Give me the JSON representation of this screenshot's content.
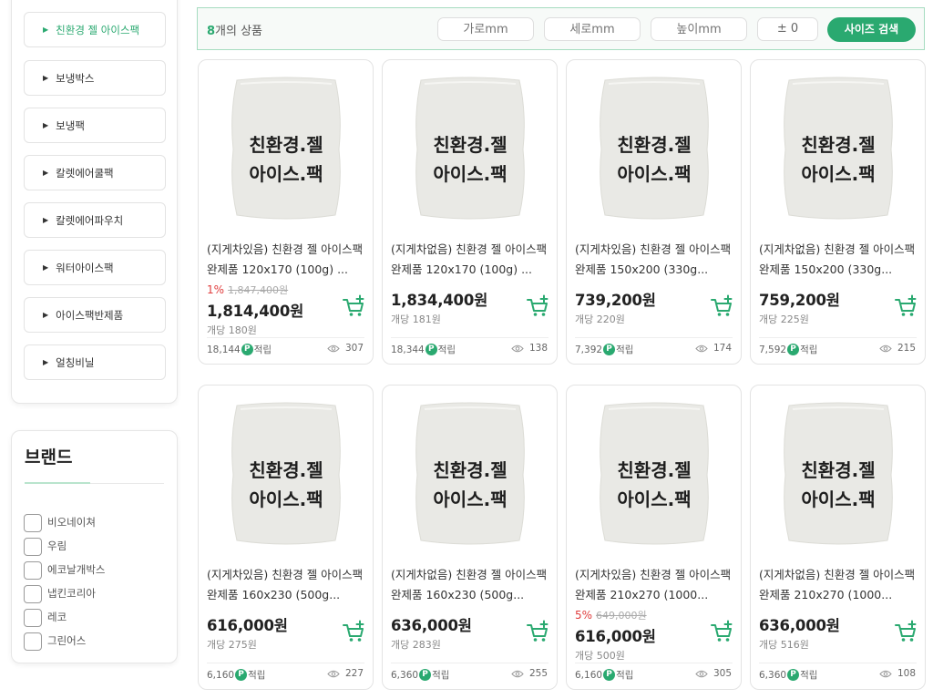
{
  "sidebar": {
    "categories": [
      {
        "label": "친환경 젤 아이스팩"
      },
      {
        "label": "보냉박스"
      },
      {
        "label": "보냉팩"
      },
      {
        "label": "칼렛에어쿨팩"
      },
      {
        "label": "칼렛에어파우치"
      },
      {
        "label": "워터아이스팩"
      },
      {
        "label": "아이스팩반제품"
      },
      {
        "label": "얼칭비닐"
      }
    ],
    "brand_title": "브랜드",
    "brands": [
      "비오네이쳐",
      "우림",
      "에코날개박스",
      "냅킨코리아",
      "레코",
      "그린어스"
    ]
  },
  "search": {
    "count_number": "8",
    "count_suffix": "개의 상품",
    "width_placeholder": "가로mm",
    "depth_placeholder": "세로mm",
    "height_placeholder": "높이mm",
    "tolerance": "± 0",
    "button": "사이즈 검색"
  },
  "colors": {
    "accent": "#2aa970",
    "discount": "#e03c3c",
    "bag": "#e9e9e5"
  },
  "icons": {
    "cart": "cart-plus-icon",
    "views": "eye-icon",
    "points": "point-badge-icon",
    "bullet": "triangle-right-icon"
  },
  "product_image_text": [
    "친환경.젤",
    "아이스.팩"
  ],
  "point_badge": "P",
  "points_label": "적립",
  "products": [
    {
      "title": "(지게차있음) 친환경 젤 아이스팩 완제품 120x170 (100g) ...",
      "discount": "1%",
      "original_price": "1,847,400원",
      "price": "1,814,400원",
      "unit_price": "개당 180원",
      "points": "18,144",
      "views": "307"
    },
    {
      "title": "(지게차없음) 친환경 젤 아이스팩 완제품 120x170 (100g) ...",
      "discount": "",
      "original_price": "",
      "price": "1,834,400원",
      "unit_price": "개당 181원",
      "points": "18,344",
      "views": "138"
    },
    {
      "title": "(지게차있음) 친환경 젤 아이스팩 완제품 150x200 (330g...",
      "discount": "",
      "original_price": "",
      "price": "739,200원",
      "unit_price": "개당 220원",
      "points": "7,392",
      "views": "174"
    },
    {
      "title": "(지게차없음) 친환경 젤 아이스팩 완제품 150x200 (330g...",
      "discount": "",
      "original_price": "",
      "price": "759,200원",
      "unit_price": "개당 225원",
      "points": "7,592",
      "views": "215"
    },
    {
      "title": "(지게차있음) 친환경 젤 아이스팩 완제품 160x230 (500g...",
      "discount": "",
      "original_price": "",
      "price": "616,000원",
      "unit_price": "개당 275원",
      "points": "6,160",
      "views": "227"
    },
    {
      "title": "(지게차없음) 친환경 젤 아이스팩 완제품 160x230 (500g...",
      "discount": "",
      "original_price": "",
      "price": "636,000원",
      "unit_price": "개당 283원",
      "points": "6,360",
      "views": "255"
    },
    {
      "title": "(지게차있음) 친환경 젤 아이스팩 완제품 210x270 (1000...",
      "discount": "5%",
      "original_price": "649,000원",
      "price": "616,000원",
      "unit_price": "개당 500원",
      "points": "6,160",
      "views": "305"
    },
    {
      "title": "(지게차없음) 친환경 젤 아이스팩 완제품 210x270 (1000...",
      "discount": "",
      "original_price": "",
      "price": "636,000원",
      "unit_price": "개당 516원",
      "points": "6,360",
      "views": "108"
    }
  ]
}
